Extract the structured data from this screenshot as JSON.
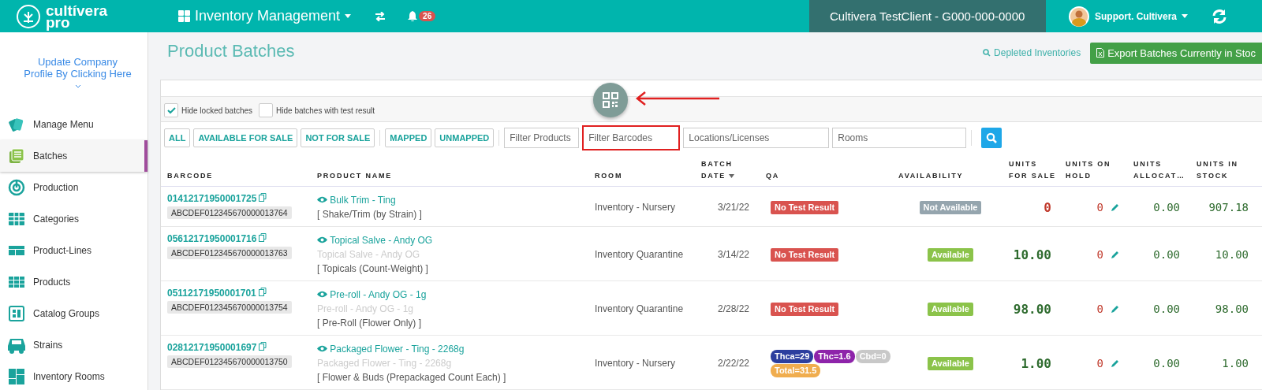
{
  "header": {
    "logo_line1": "cultívera",
    "logo_line2": "pro",
    "module": "Inventory Management",
    "notifications": "26",
    "client": "Cultivera TestClient - G000-000-0000",
    "user": "Support. Cultivera"
  },
  "sidebar": {
    "profile_link": "Update Company Profile By Clicking Here",
    "items": [
      {
        "label": "Manage Menu",
        "kind": "cards",
        "selected": false
      },
      {
        "label": "Batches",
        "kind": "list",
        "selected": true
      },
      {
        "label": "Production",
        "kind": "target",
        "selected": false
      },
      {
        "label": "Categories",
        "kind": "table",
        "selected": false
      },
      {
        "label": "Product-Lines",
        "kind": "lines",
        "selected": false
      },
      {
        "label": "Products",
        "kind": "grid",
        "selected": false
      },
      {
        "label": "Catalog Groups",
        "kind": "catalog",
        "selected": false
      },
      {
        "label": "Strains",
        "kind": "car",
        "selected": false
      },
      {
        "label": "Inventory Rooms",
        "kind": "rooms",
        "selected": false
      }
    ]
  },
  "page": {
    "title": "Product Batches",
    "depleted_link": "Depleted Inventories",
    "export_button": "Export Batches Currently in Stoc",
    "qr_annotated": true
  },
  "options": [
    {
      "label": "Hide locked batches",
      "checked": true
    },
    {
      "label": "Hide batches with test result",
      "checked": false
    }
  ],
  "filter_buttons": [
    "ALL",
    "AVAILABLE FOR SALE",
    "NOT FOR SALE",
    "MAPPED",
    "UNMAPPED"
  ],
  "filter_fields": [
    {
      "placeholder": "Filter Products",
      "highlighted": false
    },
    {
      "placeholder": "Filter Barcodes",
      "highlighted": true
    },
    {
      "placeholder": "Locations/Licenses",
      "highlighted": false
    },
    {
      "placeholder": "Rooms",
      "highlighted": false
    }
  ],
  "table": {
    "columns": [
      {
        "label": "BARCODE",
        "sorted": false
      },
      {
        "label": "PRODUCT NAME",
        "sorted": false
      },
      {
        "label": "ROOM",
        "sorted": false
      },
      {
        "label": "BATCH DATE",
        "sorted": true
      },
      {
        "label": "QA",
        "sorted": false
      },
      {
        "label": "AVAILABILITY",
        "sorted": false
      },
      {
        "label": "UNITS FOR SALE",
        "sorted": false
      },
      {
        "label": "UNITS ON HOLD",
        "sorted": false
      },
      {
        "label": "UNITS ALLOCAT…",
        "sorted": false
      },
      {
        "label": "UNITS IN STOCK",
        "sorted": false
      }
    ],
    "rows": [
      {
        "barcode": "01412171950001725",
        "code": "ABCDEF012345670000013764",
        "product": "Bulk Trim - Ting",
        "category": "[ Shake/Trim (by Strain) ]",
        "room": "Inventory - Nursery",
        "date": "3/21/22",
        "qa": [
          {
            "text": "No Test Result",
            "color": "#d9534f"
          }
        ],
        "availability": {
          "text": "Not Available",
          "available": false
        },
        "for_sale": "0",
        "for_sale_alert": true,
        "on_hold": "0",
        "allocated": "0.00",
        "in_stock": "907.18"
      },
      {
        "barcode": "05612171950001716",
        "code": "ABCDEF012345670000013763",
        "product": "Topical Salve - Andy OG",
        "alias": "Topical Salve - Andy OG",
        "category": "[ Topicals (Count-Weight) ]",
        "room": "Inventory Quarantine",
        "date": "3/14/22",
        "qa": [
          {
            "text": "No Test Result",
            "color": "#d9534f"
          }
        ],
        "availability": {
          "text": "Available",
          "available": true
        },
        "for_sale": "10.00",
        "for_sale_alert": false,
        "on_hold": "0",
        "allocated": "0.00",
        "in_stock": "10.00"
      },
      {
        "barcode": "05112171950001701",
        "code": "ABCDEF012345670000013754",
        "product": "Pre-roll - Andy OG - 1g",
        "alias": "Pre-roll - Andy OG - 1g",
        "category": "[ Pre-Roll (Flower Only) ]",
        "room": "Inventory Quarantine",
        "date": "2/28/22",
        "qa": [
          {
            "text": "No Test Result",
            "color": "#d9534f"
          }
        ],
        "availability": {
          "text": "Available",
          "available": true
        },
        "for_sale": "98.00",
        "for_sale_alert": false,
        "on_hold": "0",
        "allocated": "0.00",
        "in_stock": "98.00"
      },
      {
        "barcode": "02812171950001697",
        "code": "ABCDEF012345670000013750",
        "product": "Packaged Flower - Ting - 2268g",
        "alias": "Packaged Flower - Ting - 2268g",
        "category": "[ Flower & Buds (Prepackaged Count Each) ]",
        "room": "Inventory - Nursery",
        "date": "2/22/22",
        "qa": [
          {
            "text": "Thca=29",
            "color": "#2c3e9e"
          },
          {
            "text": "Thc=1.6",
            "color": "#8e24aa"
          },
          {
            "text": "Cbd=0",
            "color": "#c8c8c8"
          },
          {
            "text": "Total=31.5",
            "color": "#f0ad4e"
          }
        ],
        "availability": {
          "text": "Available",
          "available": true
        },
        "for_sale": "1.00",
        "for_sale_alert": false,
        "on_hold": "0",
        "allocated": "0.00",
        "in_stock": "1.00"
      }
    ]
  }
}
